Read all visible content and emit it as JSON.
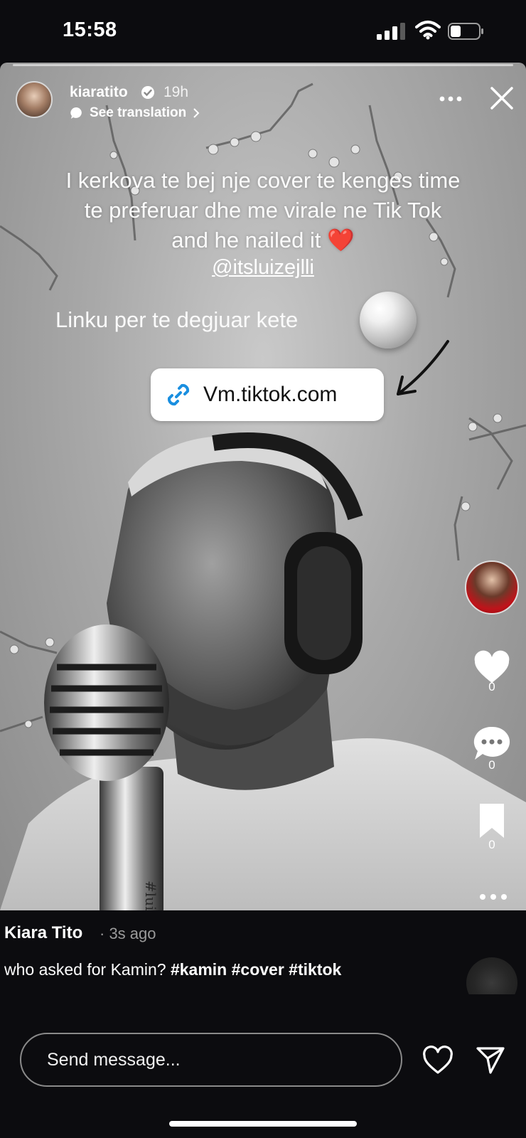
{
  "status_bar": {
    "time": "15:58"
  },
  "story": {
    "username": "kiaratito",
    "time_ago": "19h",
    "see_translation": "See translation",
    "caption_lines": [
      "I kerkova te bej nje cover te kenges time",
      "te preferuar dhe me virale ne Tik Tok",
      "and he nailed it ❤️"
    ],
    "mention": "@itsluizejlli",
    "link_intro": "Linku per te degjuar kete",
    "link_sticker_label": "Vm.tiktok.com",
    "mic_engraving": "#luizejlli"
  },
  "rail": {
    "like_count": "0",
    "comment_count": "0",
    "save_count": "0"
  },
  "post": {
    "author": "Kiara Tito",
    "time": "· 3s ago",
    "caption": "who asked for Kamin?",
    "hashtags": "#kamin #cover #tiktok"
  },
  "composer": {
    "placeholder": "Send message..."
  }
}
